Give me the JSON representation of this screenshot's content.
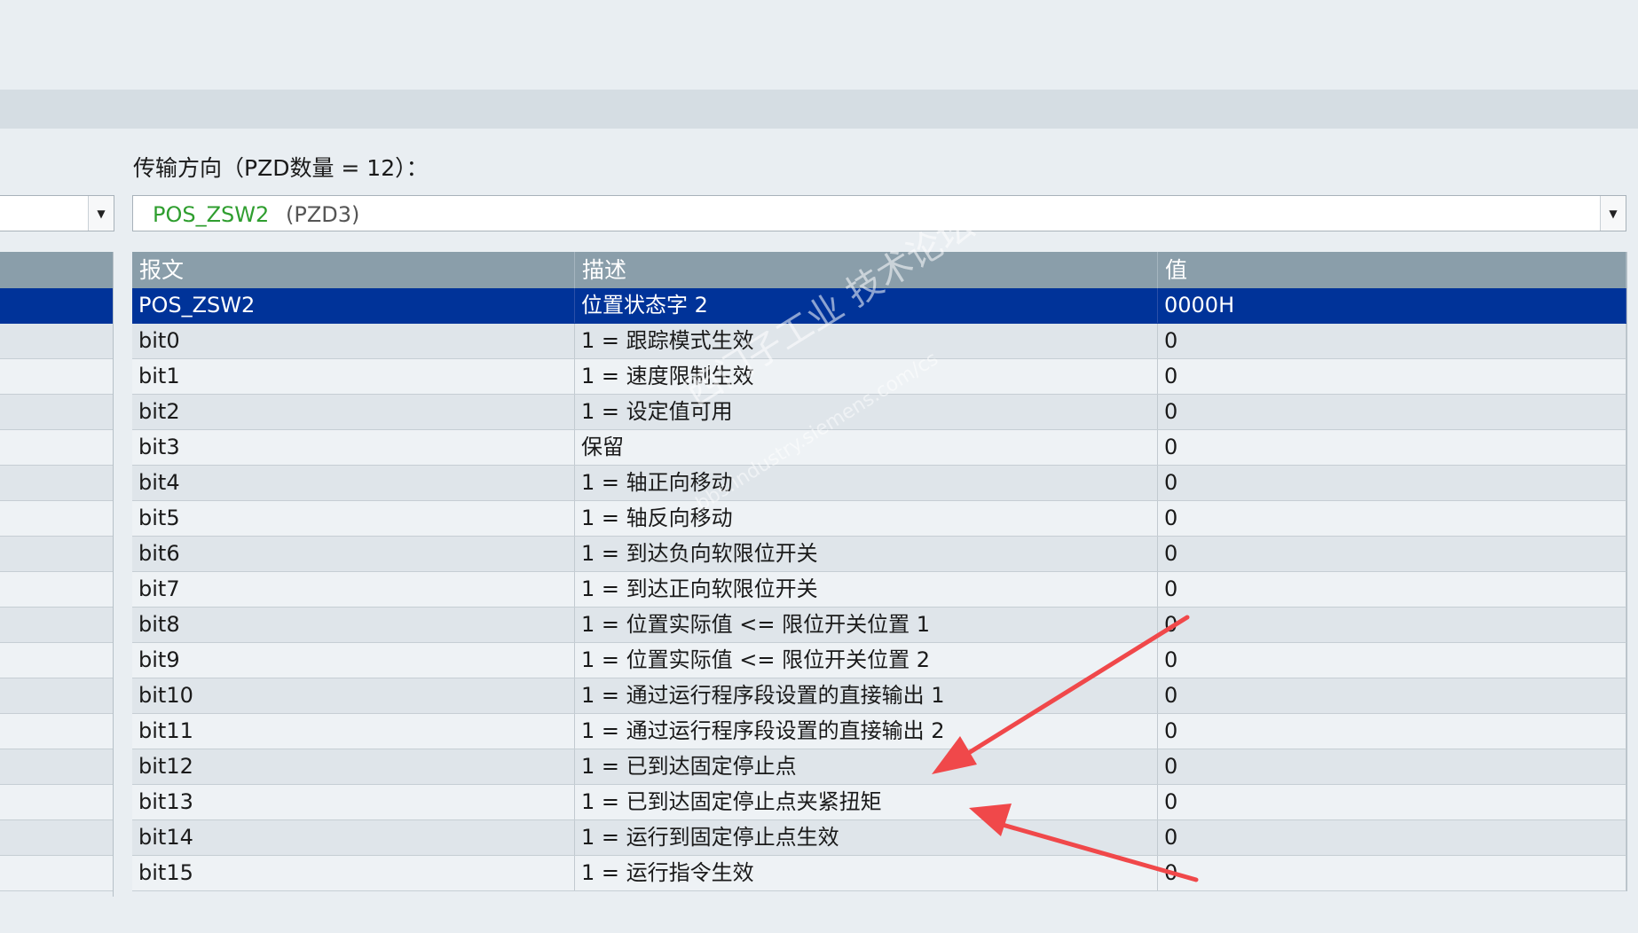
{
  "direction_label": "传输方向（PZD数量 = 12）：",
  "combo": {
    "selected_name": "POS_ZSW2",
    "selected_pzd": "(PZD3)"
  },
  "table": {
    "headers": [
      "报文",
      "描述",
      "值"
    ],
    "rows": [
      {
        "telegram": "POS_ZSW2",
        "description": "位置状态字 2",
        "value": "0000H",
        "selected": true
      },
      {
        "telegram": "bit0",
        "description": "1 = 跟踪模式生效",
        "value": "0"
      },
      {
        "telegram": "bit1",
        "description": "1 = 速度限制生效",
        "value": "0"
      },
      {
        "telegram": "bit2",
        "description": "1 = 设定值可用",
        "value": "0"
      },
      {
        "telegram": "bit3",
        "description": "保留",
        "value": "0"
      },
      {
        "telegram": "bit4",
        "description": "1 = 轴正向移动",
        "value": "0"
      },
      {
        "telegram": "bit5",
        "description": "1 = 轴反向移动",
        "value": "0"
      },
      {
        "telegram": "bit6",
        "description": "1 = 到达负向软限位开关",
        "value": "0"
      },
      {
        "telegram": "bit7",
        "description": "1 = 到达正向软限位开关",
        "value": "0"
      },
      {
        "telegram": "bit8",
        "description": "1 = 位置实际值 <= 限位开关位置 1",
        "value": "0"
      },
      {
        "telegram": "bit9",
        "description": "1 = 位置实际值 <= 限位开关位置 2",
        "value": "0"
      },
      {
        "telegram": "bit10",
        "description": "1 = 通过运行程序段设置的直接输出 1",
        "value": "0"
      },
      {
        "telegram": "bit11",
        "description": "1 = 通过运行程序段设置的直接输出 2",
        "value": "0"
      },
      {
        "telegram": "bit12",
        "description": "1 = 已到达固定停止点",
        "value": "0"
      },
      {
        "telegram": "bit13",
        "description": "1 = 已到达固定停止点夹紧扭矩",
        "value": "0"
      },
      {
        "telegram": "bit14",
        "description": "1 = 运行到固定停止点生效",
        "value": "0"
      },
      {
        "telegram": "bit15",
        "description": "1 = 运行指令生效",
        "value": "0"
      }
    ]
  },
  "watermark": {
    "line1": "西门子工业 技术论坛",
    "line2": "bbs.industry.siemens.com/cs"
  },
  "colors": {
    "header_bg": "#8a9eaa",
    "selected_row_bg": "#003399",
    "selected_name_text": "#2f9e2f",
    "annotation_arrow": "#f0484a"
  }
}
